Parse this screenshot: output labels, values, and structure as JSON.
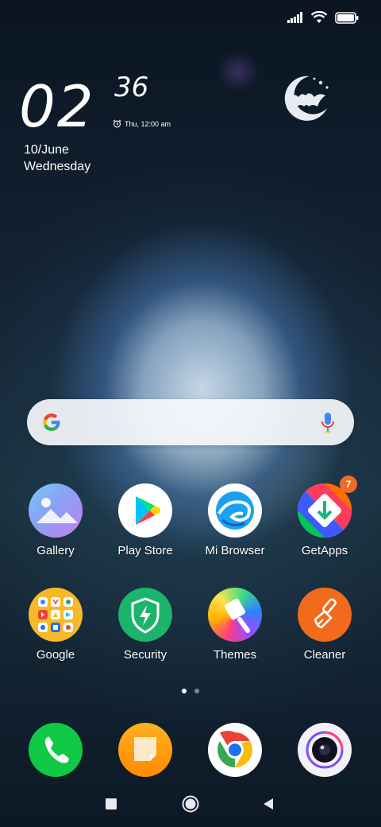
{
  "status_bar": {
    "signal": "signal-icon",
    "wifi": "wifi-icon",
    "battery": "battery-icon"
  },
  "clock": {
    "hours": "02",
    "minutes": "36",
    "alarm": "Thu, 12:00 am"
  },
  "date": {
    "day": "10/June",
    "weekday": "Wednesday"
  },
  "weather_widget": {
    "icon": "moon-bat-icon"
  },
  "search": {
    "logo": "google-g-icon",
    "mic": "mic-icon"
  },
  "apps_row1": [
    {
      "label": "Gallery"
    },
    {
      "label": "Play Store"
    },
    {
      "label": "Mi Browser"
    },
    {
      "label": "GetApps",
      "badge": "7"
    }
  ],
  "apps_row2": [
    {
      "label": "Google"
    },
    {
      "label": "Security"
    },
    {
      "label": "Themes"
    },
    {
      "label": "Cleaner"
    }
  ],
  "dock": [
    {
      "name": "Phone"
    },
    {
      "name": "Messaging"
    },
    {
      "name": "Chrome"
    },
    {
      "name": "Camera"
    }
  ],
  "page_indicator": {
    "pages": 2,
    "active": 1
  },
  "navbar": {
    "recents": "square-icon",
    "home": "circle-icon",
    "back": "triangle-icon"
  }
}
